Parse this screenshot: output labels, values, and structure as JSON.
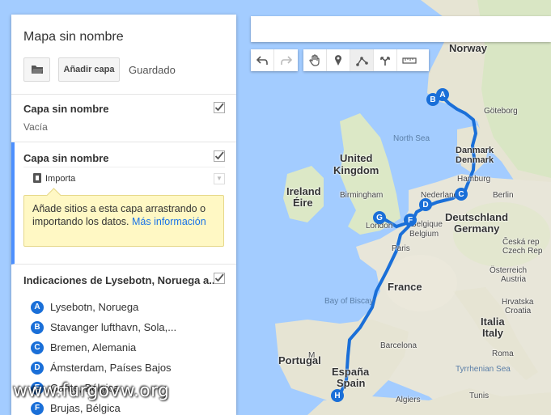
{
  "panel": {
    "map_title": "Mapa sin nombre",
    "add_layer_label": "Añadir capa",
    "saved_status": "Guardado",
    "layers": [
      {
        "title": "Capa sin nombre",
        "checked": true,
        "empty_text": "Vacía"
      },
      {
        "title": "Capa sin nombre",
        "checked": true,
        "import_label": "Importa",
        "tip_text": "Añade sitios a esta capa arrastrando o importando los datos. ",
        "tip_link": "Más información"
      },
      {
        "title": "Indicaciones de Lysebotn, Noruega a...",
        "checked": true,
        "stops": [
          {
            "marker": "A",
            "label": "Lysebotn, Noruega"
          },
          {
            "marker": "B",
            "label": "Stavanger lufthavn, Sola,..."
          },
          {
            "marker": "C",
            "label": "Bremen, Alemania"
          },
          {
            "marker": "D",
            "label": "Ámsterdam, Países Bajos"
          },
          {
            "marker": "E",
            "label": "Gante, Bélgica"
          },
          {
            "marker": "F",
            "label": "Brujas, Bélgica"
          }
        ]
      }
    ]
  },
  "search": {
    "placeholder": ""
  },
  "toolbar": {
    "groups": [
      [
        "undo-icon",
        "redo-icon"
      ],
      [
        "hand-icon",
        "marker-icon",
        "draw-line-icon",
        "directions-icon",
        "ruler-icon"
      ]
    ]
  },
  "map": {
    "labels": {
      "norway": "Norway",
      "goteborg": "Göteborg",
      "north_sea": "North Sea",
      "denmark1": "Danmark",
      "denmark2": "Denmark",
      "hamburg": "Hamburg",
      "uk1": "United",
      "uk2": "Kingdom",
      "ireland": "Ireland",
      "eire": "Éire",
      "birmingham": "Birmingham",
      "nederland": "Nederland",
      "berlin": "Berlin",
      "deutschland": "Deutschland",
      "germany": "Germany",
      "london": "London",
      "belgique": "Belgique",
      "belgium": "Belgium",
      "ceska": "Česká rep",
      "czech": "Czech Rep",
      "paris": "Paris",
      "osterreich": "Österreich",
      "austria": "Austria",
      "france": "France",
      "bay_biscay": "Bay of Biscay",
      "hrvatska": "Hrvatska",
      "croatia": "Croatia",
      "italia": "Italia",
      "italy": "Italy",
      "portugal": "Portugal",
      "barcelona": "Barcelona",
      "espana": "España",
      "spain": "Spain",
      "roma": "Roma",
      "tyrrhenian": "Tyrrhenian Sea",
      "madrid": "M",
      "algiers": "Algiers",
      "tunis": "Tunis"
    },
    "route_markers": [
      "A",
      "B",
      "C",
      "D",
      "F",
      "G",
      "H"
    ],
    "colors": {
      "route": "#1a6fd8",
      "water": "#a3ccff",
      "land": "#e8e6d9"
    }
  },
  "watermark": "www.furgovw.org"
}
